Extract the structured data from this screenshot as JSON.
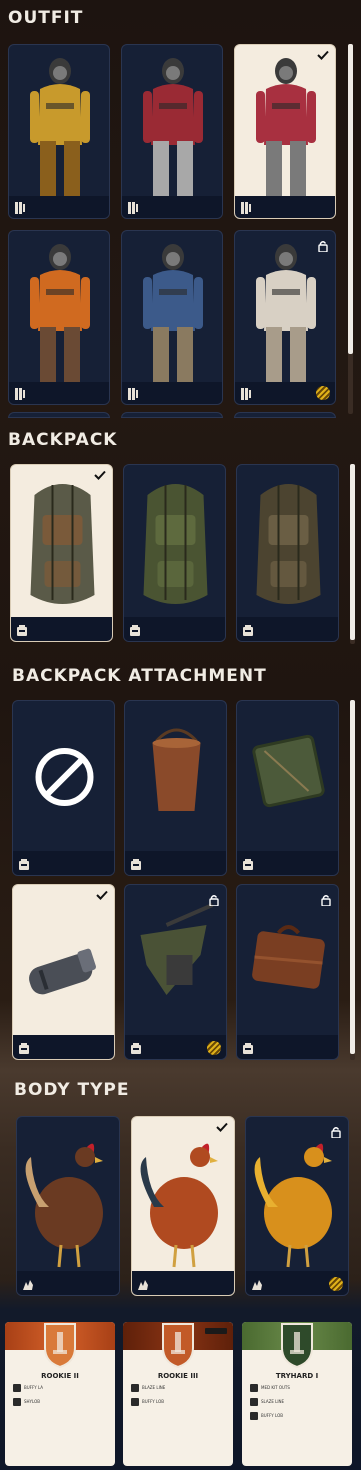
{
  "sections": {
    "outfit": "OUTFIT",
    "backpack": "BACKPACK",
    "attachment": "BACKPACK ATTACHMENT",
    "body_type": "BODY TYPE"
  },
  "outfit_cards": [
    {
      "name": "outfit-yellow-hazmat",
      "selected": false,
      "locked": false,
      "coin": false,
      "type_icon": "outfit-icon",
      "colors": [
        "#c89a2c",
        "#8a5f1c"
      ]
    },
    {
      "name": "outfit-red-harness",
      "selected": false,
      "locked": false,
      "coin": false,
      "type_icon": "outfit-icon",
      "colors": [
        "#9a2a34",
        "#a8a8a8"
      ]
    },
    {
      "name": "outfit-red-grey",
      "selected": true,
      "locked": false,
      "coin": false,
      "type_icon": "outfit-icon",
      "colors": [
        "#a83040",
        "#7a7a7a"
      ]
    },
    {
      "name": "outfit-orange-worker",
      "selected": false,
      "locked": false,
      "coin": false,
      "type_icon": "outfit-icon",
      "colors": [
        "#d06a20",
        "#6a4a34"
      ]
    },
    {
      "name": "outfit-blue-overalls",
      "selected": false,
      "locked": false,
      "coin": false,
      "type_icon": "outfit-icon",
      "colors": [
        "#3c5a8a",
        "#8a7a60"
      ]
    },
    {
      "name": "outfit-astronaut",
      "selected": false,
      "locked": true,
      "coin": true,
      "type_icon": "outfit-icon",
      "colors": [
        "#d8d0c4",
        "#a89c8a"
      ]
    }
  ],
  "backpack_cards": [
    {
      "name": "backpack-radio-pack",
      "selected": true,
      "locked": false,
      "coin": false,
      "type_icon": "backpack-icon",
      "colors": [
        "#5a5a48",
        "#7a5a3a"
      ]
    },
    {
      "name": "backpack-green-rucksack",
      "selected": false,
      "locked": false,
      "coin": false,
      "type_icon": "backpack-icon",
      "colors": [
        "#4a5432",
        "#5e6a3e"
      ]
    },
    {
      "name": "backpack-olive-rucksack",
      "selected": false,
      "locked": false,
      "coin": false,
      "type_icon": "backpack-icon",
      "colors": [
        "#4c4430",
        "#6a5e44"
      ]
    }
  ],
  "attachment_cards": [
    {
      "name": "attachment-none",
      "selected": false,
      "locked": false,
      "coin": false,
      "type_icon": "backpack-icon",
      "colors": [
        "#ffffff",
        "#ffffff"
      ]
    },
    {
      "name": "attachment-bucket",
      "selected": false,
      "locked": false,
      "coin": false,
      "type_icon": "backpack-icon",
      "colors": [
        "#8a4a2a",
        "#a86438"
      ]
    },
    {
      "name": "attachment-green-box",
      "selected": false,
      "locked": false,
      "coin": false,
      "type_icon": "backpack-icon",
      "colors": [
        "#4c5a3a",
        "#6a7650"
      ]
    },
    {
      "name": "attachment-canister",
      "selected": true,
      "locked": false,
      "coin": false,
      "type_icon": "backpack-icon",
      "colors": [
        "#4a4e56",
        "#6a6e78"
      ]
    },
    {
      "name": "attachment-tarp-bundle",
      "selected": false,
      "locked": true,
      "coin": true,
      "type_icon": "backpack-icon",
      "colors": [
        "#4a5236",
        "#3a3a3a"
      ]
    },
    {
      "name": "attachment-suitcase",
      "selected": false,
      "locked": true,
      "coin": false,
      "type_icon": "backpack-icon",
      "colors": [
        "#7a3e22",
        "#94522e"
      ]
    }
  ],
  "body_cards": [
    {
      "name": "body-brown-chicken",
      "selected": false,
      "locked": false,
      "coin": false,
      "type_icon": "chicken-icon",
      "colors": [
        "#6a3a22",
        "#c8a070"
      ]
    },
    {
      "name": "body-red-rooster",
      "selected": true,
      "locked": false,
      "coin": false,
      "type_icon": "chicken-icon",
      "colors": [
        "#b04a20",
        "#2a3a4a"
      ]
    },
    {
      "name": "body-golden-rooster",
      "selected": false,
      "locked": true,
      "coin": true,
      "type_icon": "chicken-icon",
      "colors": [
        "#d8901c",
        "#e8b030"
      ]
    }
  ],
  "ranks": [
    {
      "name": "ROOKIE II",
      "band": "#d4612a",
      "band2": "#a84016",
      "shield": "#d97a3a",
      "reqs": [
        "BUFFY LA",
        "SHYLOB"
      ]
    },
    {
      "name": "ROOKIE III",
      "band": "#8a3414",
      "band2": "#5e200a",
      "shield": "#c25a28",
      "reqs": [
        "BLAZE LINE",
        "BUFFY LOB"
      ]
    },
    {
      "name": "TRYHARD I",
      "band": "#6a8a4a",
      "band2": "#4a6a30",
      "shield": "#2e4a2a",
      "reqs": [
        "MED KIT OUTS",
        "SLAZE LINE",
        "BUFFY LOB"
      ]
    }
  ]
}
